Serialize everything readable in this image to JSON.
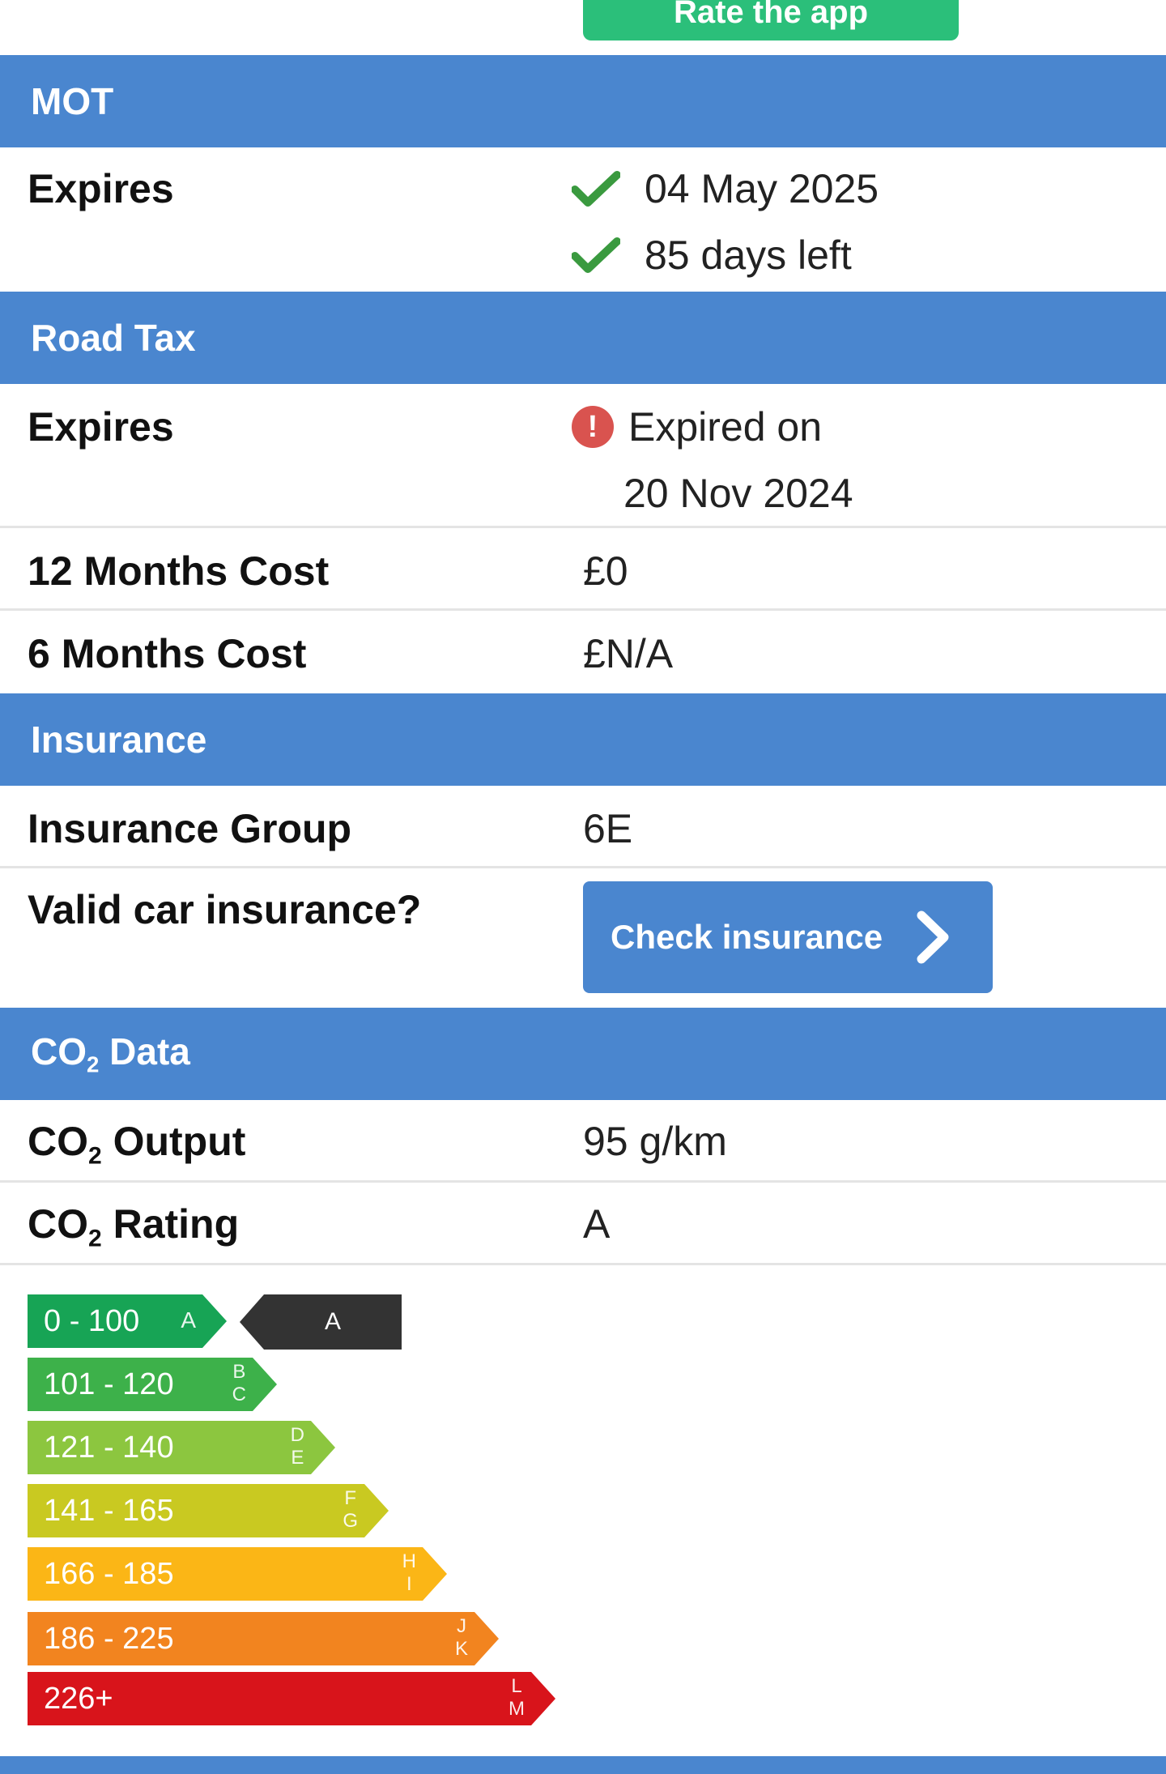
{
  "top": {
    "rate_button_label": "Rate the app"
  },
  "mot": {
    "header": "MOT",
    "expires_label": "Expires",
    "expiry_date": "04 May 2025",
    "days_left": "85 days left"
  },
  "road_tax": {
    "header": "Road Tax",
    "expires_label": "Expires",
    "expired_line1": "Expired on",
    "expired_line2": "20 Nov 2024",
    "cost_12_label": "12 Months Cost",
    "cost_12_value": "£0",
    "cost_6_label": "6 Months Cost",
    "cost_6_value": "£N/A"
  },
  "insurance": {
    "header": "Insurance",
    "group_label": "Insurance Group",
    "group_value": "6E",
    "valid_label": "Valid car insurance?",
    "check_button": "Check insurance"
  },
  "co2": {
    "header_prefix": "CO",
    "header_sub": "2",
    "header_suffix": " Data",
    "output_prefix": "CO",
    "output_sub": "2",
    "output_suffix": " Output",
    "output_value": "95 g/km",
    "rating_prefix": "CO",
    "rating_sub": "2",
    "rating_suffix": " Rating",
    "rating_value": "A",
    "marker_label": "A",
    "bands": [
      {
        "range": "0 - 100",
        "letters": [
          "A"
        ],
        "color": "#17a455"
      },
      {
        "range": "101 - 120",
        "letters": [
          "B",
          "C"
        ],
        "color": "#3db14a"
      },
      {
        "range": "121 - 140",
        "letters": [
          "D",
          "E"
        ],
        "color": "#8cc63f"
      },
      {
        "range": "141 - 165",
        "letters": [
          "F",
          "G"
        ],
        "color": "#c9c921"
      },
      {
        "range": "166 - 185",
        "letters": [
          "H",
          "I"
        ],
        "color": "#fbb616"
      },
      {
        "range": "186 - 225",
        "letters": [
          "J",
          "K"
        ],
        "color": "#f2841f"
      },
      {
        "range": "226+",
        "letters": [
          "L",
          "M"
        ],
        "color": "#d8141b"
      }
    ]
  },
  "colors": {
    "header_blue": "#4a86cf",
    "button_green": "#2bbf7a",
    "check_green": "#3a9a3f",
    "alert_red": "#d9534f"
  }
}
